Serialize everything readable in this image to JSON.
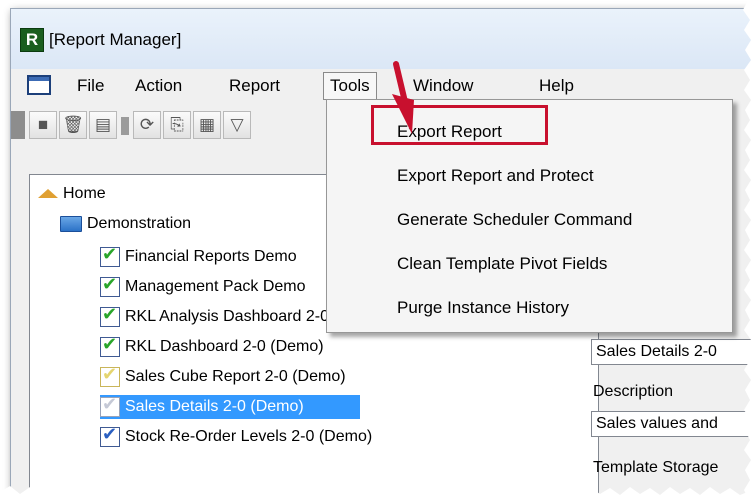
{
  "window": {
    "title": "[Report Manager]",
    "app_icon_letter": "R"
  },
  "menubar": {
    "items": [
      "File",
      "Action",
      "Report",
      "Tools",
      "Window",
      "Help"
    ]
  },
  "tools_menu": {
    "items": [
      "Export Report",
      "Export Report and Protect",
      "Generate Scheduler Command",
      "Clean Template Pivot Fields",
      "Purge Instance History"
    ],
    "highlighted_item": "Export Report"
  },
  "tree": {
    "root": "Home",
    "folder": "Demonstration",
    "reports": [
      "Financial Reports Demo",
      "Management Pack Demo",
      "RKL Analysis Dashboard 2-0 (Demo)",
      "RKL Dashboard 2-0 (Demo)",
      "Sales Cube Report 2-0 (Demo)",
      "Sales Details 2-0 (Demo)",
      "Stock Re-Order Levels 2-0 (Demo)"
    ],
    "selected_report": "Sales Details 2-0 (Demo)"
  },
  "properties": {
    "name_value": "Sales Details 2-0",
    "description_label": "Description",
    "description_value": "Sales values and",
    "template_storage_label": "Template Storage"
  },
  "colors": {
    "highlight_border": "#c8102e",
    "selection": "#3399ff",
    "arrow": "#c8102e"
  }
}
